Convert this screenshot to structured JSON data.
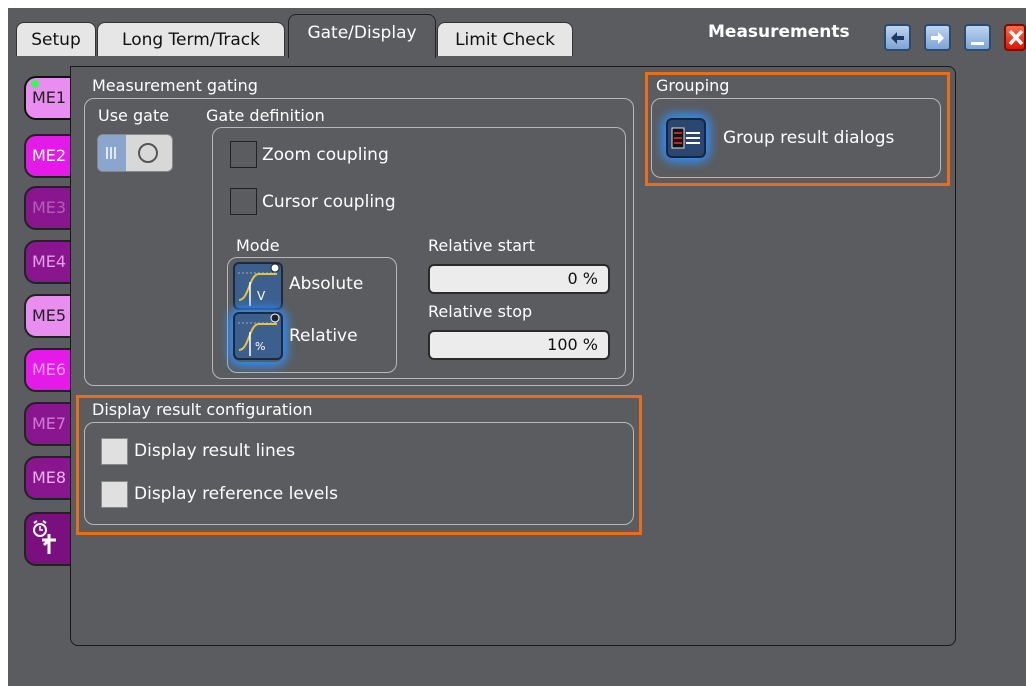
{
  "window": {
    "title": "Measurements"
  },
  "tabs": [
    {
      "label": "Setup"
    },
    {
      "label": "Long Term/Track"
    },
    {
      "label": "Gate/Display"
    },
    {
      "label": "Limit Check"
    }
  ],
  "side_tabs": [
    {
      "label": "ME1",
      "color": "#e98ef0",
      "text_color": "#222222"
    },
    {
      "label": "ME2",
      "color": "#e41ae8",
      "text_color": "#ffffff"
    },
    {
      "label": "ME3",
      "color": "#8a168f",
      "text_color": "#b35fb8"
    },
    {
      "label": "ME4",
      "color": "#8a168f",
      "text_color": "#e0a0e4"
    },
    {
      "label": "ME5",
      "color": "#e98ef0",
      "text_color": "#222222"
    },
    {
      "label": "ME6",
      "color": "#e41ae8",
      "text_color": "#ff9cff"
    },
    {
      "label": "ME7",
      "color": "#8a168f",
      "text_color": "#d07ad6"
    },
    {
      "label": "ME8",
      "color": "#8a168f",
      "text_color": "#e8b6ec"
    }
  ],
  "gating": {
    "title": "Measurement gating",
    "use_gate_label": "Use gate",
    "use_gate_on": false,
    "gate_definition_title": "Gate definition",
    "zoom_coupling": "Zoom coupling",
    "cursor_coupling": "Cursor coupling",
    "mode_title": "Mode",
    "absolute_label": "Absolute",
    "relative_label": "Relative",
    "relative_start_label": "Relative start",
    "relative_start_value": "0 %",
    "relative_stop_label": "Relative stop",
    "relative_stop_value": "100 %"
  },
  "display_config": {
    "title": "Display result configuration",
    "result_lines": "Display result lines",
    "reference_levels": "Display reference levels"
  },
  "grouping": {
    "title": "Grouping",
    "group_button": "Group result dialogs"
  },
  "colors": {
    "background": "#5a5c5f",
    "highlight": "#e86e1a",
    "active_glow": "#2f8fff"
  }
}
